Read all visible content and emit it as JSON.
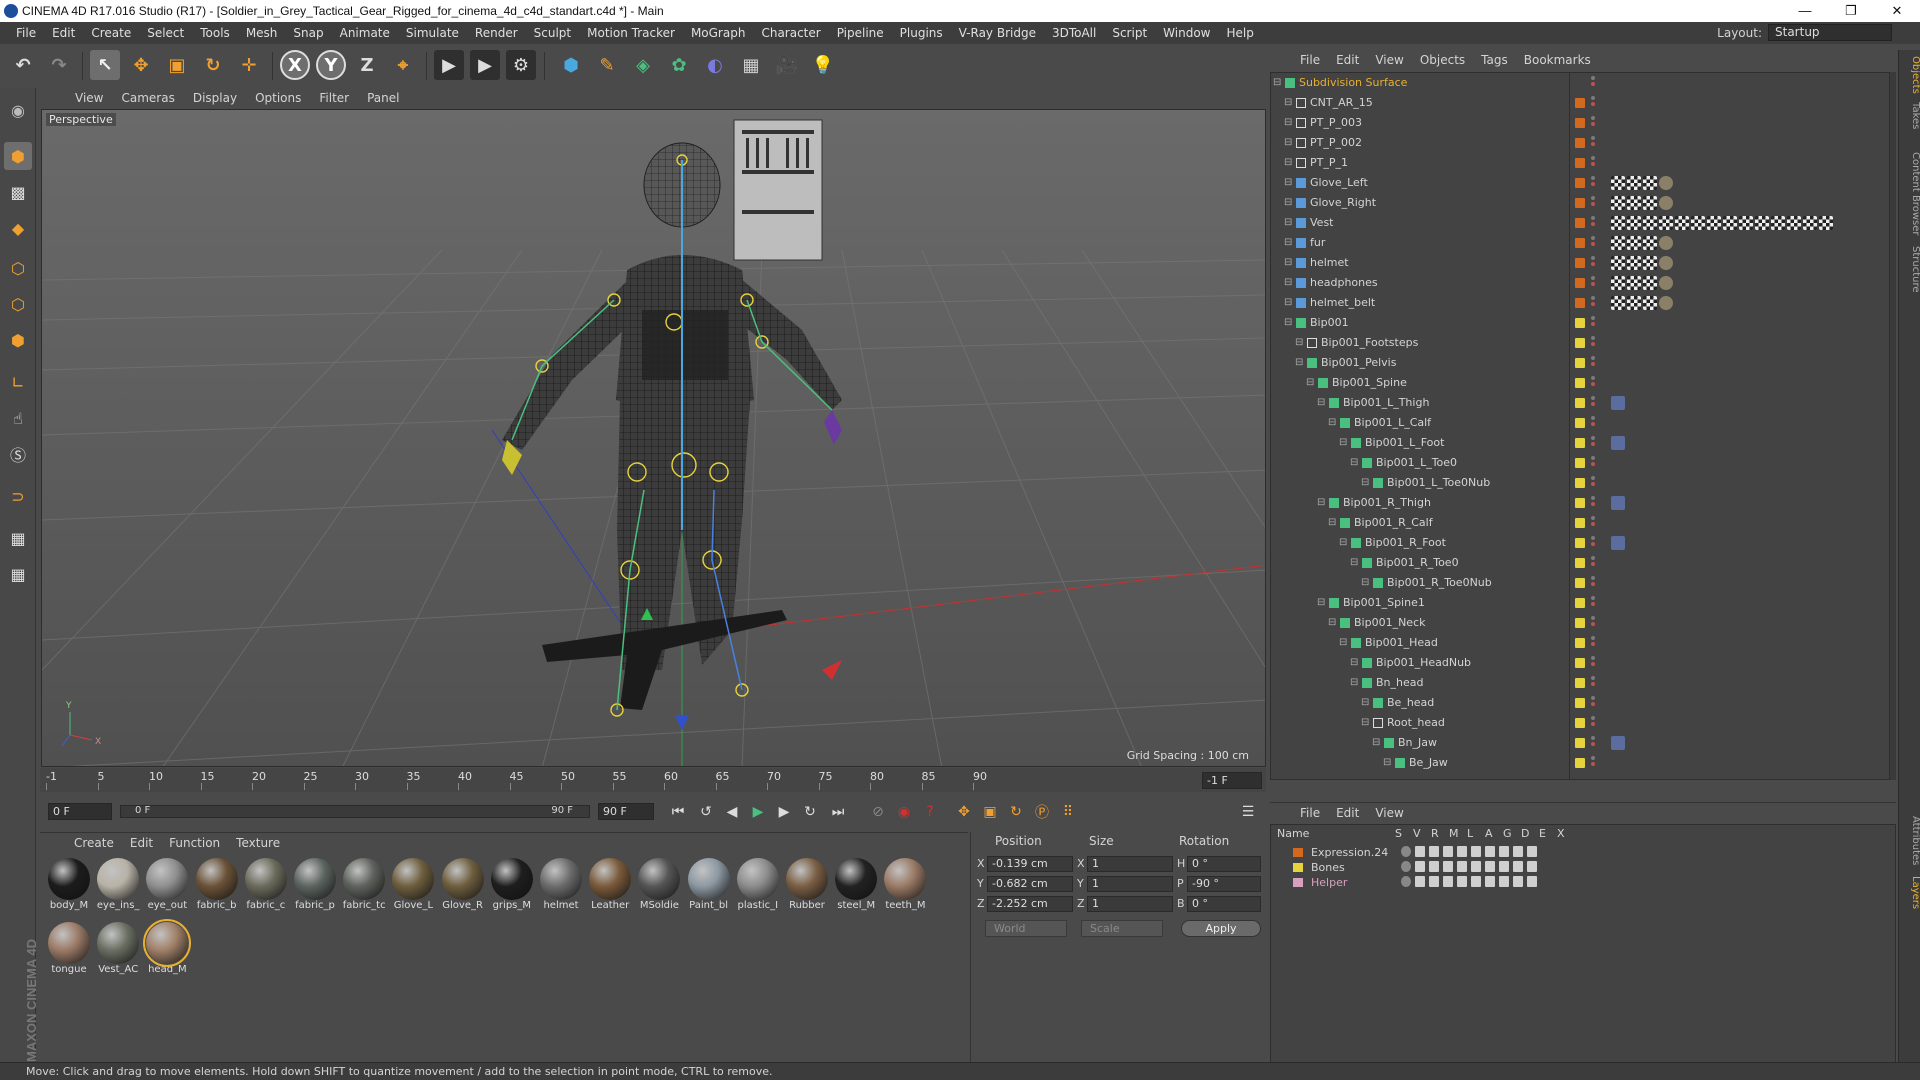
{
  "window": {
    "title": "CINEMA 4D R17.016 Studio (R17) - [Soldier_in_Grey_Tactical_Gear_Rigged_for_cinema_4d_c4d_standart.c4d *] - Main",
    "minimize": "—",
    "maximize": "❐",
    "close": "✕"
  },
  "menubar": {
    "items": [
      "File",
      "Edit",
      "Create",
      "Select",
      "Tools",
      "Mesh",
      "Snap",
      "Animate",
      "Simulate",
      "Render",
      "Sculpt",
      "Motion Tracker",
      "MoGraph",
      "Character",
      "Pipeline",
      "Plugins",
      "V-Ray Bridge",
      "3DToAll",
      "Script",
      "Window",
      "Help"
    ],
    "layout_label": "Layout:",
    "layout_value": "Startup"
  },
  "toolbar": {
    "undo": "↶",
    "redo": "↷",
    "select": "↖",
    "move": "✥",
    "scale": "▣",
    "rotate": "↻",
    "live": "✛",
    "x": "X",
    "y": "Y",
    "z": "Z",
    "coord": "⌖",
    "render_view": "▶",
    "render": "▶",
    "render_settings": "⚙",
    "cube": "⬢",
    "pen": "✎",
    "subdiv": "◈",
    "array": "✿",
    "deform": "◐",
    "floor": "▦",
    "camera": "🎥",
    "light": "💡"
  },
  "viewport": {
    "menu": [
      "View",
      "Cameras",
      "Display",
      "Options",
      "Filter",
      "Panel"
    ],
    "label": "Perspective",
    "grid_spacing": "Grid Spacing : 100 cm",
    "axis_y": "Y",
    "axis_x": "X"
  },
  "timeline": {
    "ticks": [
      "-1",
      "5",
      "10",
      "15",
      "20",
      "25",
      "30",
      "35",
      "40",
      "45",
      "50",
      "55",
      "60",
      "65",
      "70",
      "75",
      "80",
      "85",
      "90"
    ],
    "end_field": "-1 F",
    "start_frame": "0 F",
    "range_start": "0 F",
    "range_end": "90 F",
    "end_frame": "90 F"
  },
  "materials": {
    "menu": [
      "Create",
      "Edit",
      "Function",
      "Texture"
    ],
    "items": [
      {
        "name": "body_M",
        "color": "#1c1c1c"
      },
      {
        "name": "eye_ins_",
        "color": "#b8b2a6"
      },
      {
        "name": "eye_out",
        "color": "#8f8f8f"
      },
      {
        "name": "fabric_b",
        "color": "#6b5238"
      },
      {
        "name": "fabric_c",
        "color": "#6b6b5c"
      },
      {
        "name": "fabric_p",
        "color": "#5c6460"
      },
      {
        "name": "fabric_tc",
        "color": "#5e625c"
      },
      {
        "name": "Glove_L",
        "color": "#6e5e3e"
      },
      {
        "name": "Glove_R",
        "color": "#6e5e3e"
      },
      {
        "name": "grips_M",
        "color": "#1e1e1e"
      },
      {
        "name": "helmet",
        "color": "#6c6c6c"
      },
      {
        "name": "Leather",
        "color": "#7a5a3a"
      },
      {
        "name": "MSoldie",
        "color": "#555555"
      },
      {
        "name": "Paint_bl",
        "color": "#8c98a2"
      },
      {
        "name": "plastic_I",
        "color": "#8c8c8c"
      },
      {
        "name": "Rubber",
        "color": "#7a5e44"
      },
      {
        "name": "steel_M",
        "color": "#222222"
      },
      {
        "name": "teeth_M",
        "color": "#9a7a66"
      },
      {
        "name": "tongue",
        "color": "#9a7a66"
      },
      {
        "name": "Vest_AC",
        "color": "#6a6e62"
      },
      {
        "name": "head_M",
        "color": "#a08068"
      }
    ]
  },
  "coordinates": {
    "headers": {
      "position": "Position",
      "size": "Size",
      "rotation": "Rotation"
    },
    "rows": [
      {
        "axis": "X",
        "pos": "-0.139 cm",
        "size_axis": "X",
        "size": "1",
        "rot_axis": "H",
        "rot": "0 °"
      },
      {
        "axis": "Y",
        "pos": "-0.682 cm",
        "size_axis": "Y",
        "size": "1",
        "rot_axis": "P",
        "rot": "-90 °"
      },
      {
        "axis": "Z",
        "pos": "-2.252 cm",
        "size_axis": "Z",
        "size": "1",
        "rot_axis": "B",
        "rot": "0 °"
      }
    ],
    "mode": "World",
    "size_mode": "Scale",
    "apply": "Apply"
  },
  "objects": {
    "menu": [
      "File",
      "Edit",
      "View",
      "Objects",
      "Tags",
      "Bookmarks"
    ],
    "rows": [
      {
        "name": "Subdivision Surface",
        "indent": 0,
        "type": "subdiv",
        "color": "#e7b031",
        "dot": "",
        "tags": 0,
        "highlight": true
      },
      {
        "name": "CNT_AR_15",
        "indent": 1,
        "type": "null",
        "dot": "#d2691e",
        "tags": 0
      },
      {
        "name": "PT_P_003",
        "indent": 1,
        "type": "null",
        "dot": "#d2691e",
        "tags": 0
      },
      {
        "name": "PT_P_002",
        "indent": 1,
        "type": "null",
        "dot": "#d2691e",
        "tags": 0
      },
      {
        "name": "PT_P_1",
        "indent": 1,
        "type": "null",
        "dot": "#d2691e",
        "tags": 0
      },
      {
        "name": "Glove_Left",
        "indent": 1,
        "type": "mesh",
        "dot": "#d2691e",
        "tags": 4
      },
      {
        "name": "Glove_Right",
        "indent": 1,
        "type": "mesh",
        "dot": "#d2691e",
        "tags": 4
      },
      {
        "name": "Vest",
        "indent": 1,
        "type": "mesh",
        "dot": "#d2691e",
        "tags": 14
      },
      {
        "name": "fur",
        "indent": 1,
        "type": "mesh",
        "dot": "#d2691e",
        "tags": 4
      },
      {
        "name": "helmet",
        "indent": 1,
        "type": "mesh",
        "dot": "#d2691e",
        "tags": 4
      },
      {
        "name": "headphones",
        "indent": 1,
        "type": "mesh",
        "dot": "#d2691e",
        "tags": 4
      },
      {
        "name": "helmet_belt",
        "indent": 1,
        "type": "mesh",
        "dot": "#d2691e",
        "tags": 4
      },
      {
        "name": "Bip001",
        "indent": 1,
        "type": "bone",
        "dot": "#e6d23c",
        "tags": 0
      },
      {
        "name": "Bip001_Footsteps",
        "indent": 2,
        "type": "null",
        "dot": "#e6d23c",
        "tags": 0
      },
      {
        "name": "Bip001_Pelvis",
        "indent": 2,
        "type": "bone",
        "dot": "#e6d23c",
        "tags": 0
      },
      {
        "name": "Bip001_Spine",
        "indent": 3,
        "type": "bone",
        "dot": "#e6d23c",
        "tags": 0
      },
      {
        "name": "Bip001_L_Thigh",
        "indent": 4,
        "type": "bone",
        "dot": "#e6d23c",
        "tags": 1,
        "ik": true
      },
      {
        "name": "Bip001_L_Calf",
        "indent": 5,
        "type": "bone",
        "dot": "#e6d23c",
        "tags": 0
      },
      {
        "name": "Bip001_L_Foot",
        "indent": 6,
        "type": "bone",
        "dot": "#e6d23c",
        "tags": 1,
        "ik": true
      },
      {
        "name": "Bip001_L_Toe0",
        "indent": 7,
        "type": "bone",
        "dot": "#e6d23c",
        "tags": 0
      },
      {
        "name": "Bip001_L_Toe0Nub",
        "indent": 8,
        "type": "bone",
        "dot": "#e6d23c",
        "tags": 0
      },
      {
        "name": "Bip001_R_Thigh",
        "indent": 4,
        "type": "bone",
        "dot": "#e6d23c",
        "tags": 1,
        "ik": true
      },
      {
        "name": "Bip001_R_Calf",
        "indent": 5,
        "type": "bone",
        "dot": "#e6d23c",
        "tags": 0
      },
      {
        "name": "Bip001_R_Foot",
        "indent": 6,
        "type": "bone",
        "dot": "#e6d23c",
        "tags": 1,
        "ik": true
      },
      {
        "name": "Bip001_R_Toe0",
        "indent": 7,
        "type": "bone",
        "dot": "#e6d23c",
        "tags": 0
      },
      {
        "name": "Bip001_R_Toe0Nub",
        "indent": 8,
        "type": "bone",
        "dot": "#e6d23c",
        "tags": 0
      },
      {
        "name": "Bip001_Spine1",
        "indent": 4,
        "type": "bone",
        "dot": "#e6d23c",
        "tags": 0
      },
      {
        "name": "Bip001_Neck",
        "indent": 5,
        "type": "bone",
        "dot": "#e6d23c",
        "tags": 0
      },
      {
        "name": "Bip001_Head",
        "indent": 6,
        "type": "bone",
        "dot": "#e6d23c",
        "tags": 0
      },
      {
        "name": "Bip001_HeadNub",
        "indent": 7,
        "type": "bone",
        "dot": "#e6d23c",
        "tags": 0
      },
      {
        "name": "Bn_head",
        "indent": 7,
        "type": "bone",
        "dot": "#e6d23c",
        "tags": 0
      },
      {
        "name": "Be_head",
        "indent": 8,
        "type": "bone",
        "dot": "#e6d23c",
        "tags": 0
      },
      {
        "name": "Root_head",
        "indent": 8,
        "type": "null",
        "dot": "#e6d23c",
        "tags": 0
      },
      {
        "name": "Bn_Jaw",
        "indent": 9,
        "type": "bone",
        "dot": "#e6d23c",
        "tags": 1,
        "ik": true
      },
      {
        "name": "Be_Jaw",
        "indent": 10,
        "type": "bone",
        "dot": "#e6d23c",
        "tags": 0
      }
    ]
  },
  "layers": {
    "menu": [
      "File",
      "Edit",
      "View"
    ],
    "columns": [
      "Name",
      "S",
      "V",
      "R",
      "M",
      "L",
      "A",
      "G",
      "D",
      "E",
      "X"
    ],
    "rows": [
      {
        "name": "Expression.24",
        "color": "#d2691e",
        "highlight": false
      },
      {
        "name": "Bones",
        "color": "#e6d23c",
        "highlight": false
      },
      {
        "name": "Helper",
        "color": "#d8a0c0",
        "highlight": true
      }
    ]
  },
  "sidetabs": [
    "Objects",
    "Takes",
    "Content Browser",
    "Structure",
    "Attributes",
    "Layers"
  ],
  "status": "Move: Click and drag to move elements. Hold down SHIFT to quantize movement / add to the selection in point mode, CTRL to remove."
}
